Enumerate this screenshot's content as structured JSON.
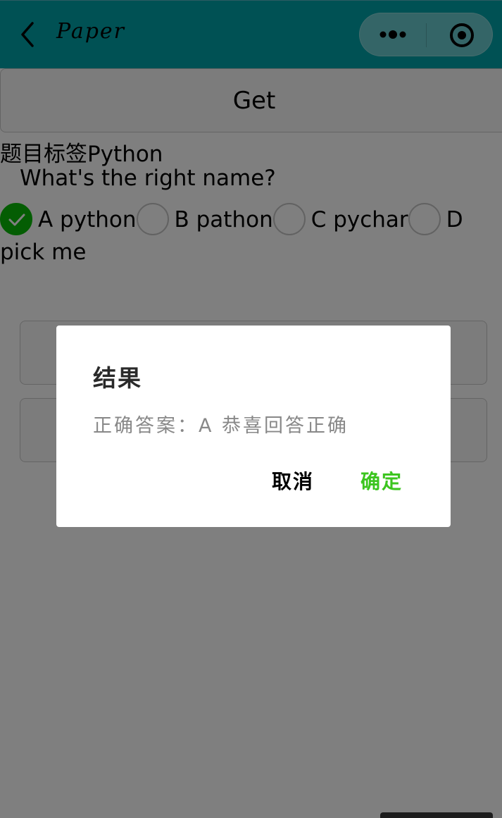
{
  "nav": {
    "title": "Paper",
    "background_color": "#00a2a8",
    "back_icon": "chevron-left-icon",
    "more_icon": "more-dots-icon",
    "close_icon": "target-close-icon"
  },
  "main": {
    "get_button_label": "Get",
    "tag_line": "题目标签Python",
    "question": "What's the right name?",
    "options": [
      {
        "label": "A python",
        "checked": true
      },
      {
        "label": "B pathon",
        "checked": false
      },
      {
        "label": "C pychar",
        "checked": false
      },
      {
        "label": "D",
        "checked": false
      }
    ],
    "options_tail": "pick me"
  },
  "modal": {
    "title": "结果",
    "content": "正确答案：A  恭喜回答正确",
    "cancel_label": "取消",
    "confirm_label": "确定",
    "confirm_color": "#3cc51f"
  },
  "colors": {
    "check": "#09bb07",
    "overlay": "rgba(0,0,0,0.5)"
  }
}
